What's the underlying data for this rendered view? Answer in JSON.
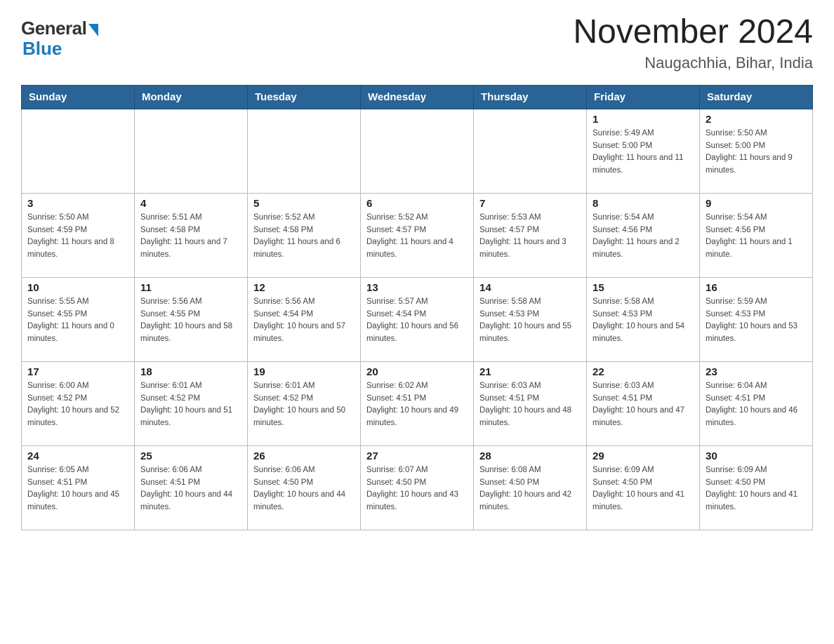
{
  "header": {
    "logo_general": "General",
    "logo_blue": "Blue",
    "month_title": "November 2024",
    "location": "Naugachhia, Bihar, India"
  },
  "days_of_week": [
    "Sunday",
    "Monday",
    "Tuesday",
    "Wednesday",
    "Thursday",
    "Friday",
    "Saturday"
  ],
  "weeks": [
    [
      {
        "day": "",
        "info": ""
      },
      {
        "day": "",
        "info": ""
      },
      {
        "day": "",
        "info": ""
      },
      {
        "day": "",
        "info": ""
      },
      {
        "day": "",
        "info": ""
      },
      {
        "day": "1",
        "info": "Sunrise: 5:49 AM\nSunset: 5:00 PM\nDaylight: 11 hours and 11 minutes."
      },
      {
        "day": "2",
        "info": "Sunrise: 5:50 AM\nSunset: 5:00 PM\nDaylight: 11 hours and 9 minutes."
      }
    ],
    [
      {
        "day": "3",
        "info": "Sunrise: 5:50 AM\nSunset: 4:59 PM\nDaylight: 11 hours and 8 minutes."
      },
      {
        "day": "4",
        "info": "Sunrise: 5:51 AM\nSunset: 4:58 PM\nDaylight: 11 hours and 7 minutes."
      },
      {
        "day": "5",
        "info": "Sunrise: 5:52 AM\nSunset: 4:58 PM\nDaylight: 11 hours and 6 minutes."
      },
      {
        "day": "6",
        "info": "Sunrise: 5:52 AM\nSunset: 4:57 PM\nDaylight: 11 hours and 4 minutes."
      },
      {
        "day": "7",
        "info": "Sunrise: 5:53 AM\nSunset: 4:57 PM\nDaylight: 11 hours and 3 minutes."
      },
      {
        "day": "8",
        "info": "Sunrise: 5:54 AM\nSunset: 4:56 PM\nDaylight: 11 hours and 2 minutes."
      },
      {
        "day": "9",
        "info": "Sunrise: 5:54 AM\nSunset: 4:56 PM\nDaylight: 11 hours and 1 minute."
      }
    ],
    [
      {
        "day": "10",
        "info": "Sunrise: 5:55 AM\nSunset: 4:55 PM\nDaylight: 11 hours and 0 minutes."
      },
      {
        "day": "11",
        "info": "Sunrise: 5:56 AM\nSunset: 4:55 PM\nDaylight: 10 hours and 58 minutes."
      },
      {
        "day": "12",
        "info": "Sunrise: 5:56 AM\nSunset: 4:54 PM\nDaylight: 10 hours and 57 minutes."
      },
      {
        "day": "13",
        "info": "Sunrise: 5:57 AM\nSunset: 4:54 PM\nDaylight: 10 hours and 56 minutes."
      },
      {
        "day": "14",
        "info": "Sunrise: 5:58 AM\nSunset: 4:53 PM\nDaylight: 10 hours and 55 minutes."
      },
      {
        "day": "15",
        "info": "Sunrise: 5:58 AM\nSunset: 4:53 PM\nDaylight: 10 hours and 54 minutes."
      },
      {
        "day": "16",
        "info": "Sunrise: 5:59 AM\nSunset: 4:53 PM\nDaylight: 10 hours and 53 minutes."
      }
    ],
    [
      {
        "day": "17",
        "info": "Sunrise: 6:00 AM\nSunset: 4:52 PM\nDaylight: 10 hours and 52 minutes."
      },
      {
        "day": "18",
        "info": "Sunrise: 6:01 AM\nSunset: 4:52 PM\nDaylight: 10 hours and 51 minutes."
      },
      {
        "day": "19",
        "info": "Sunrise: 6:01 AM\nSunset: 4:52 PM\nDaylight: 10 hours and 50 minutes."
      },
      {
        "day": "20",
        "info": "Sunrise: 6:02 AM\nSunset: 4:51 PM\nDaylight: 10 hours and 49 minutes."
      },
      {
        "day": "21",
        "info": "Sunrise: 6:03 AM\nSunset: 4:51 PM\nDaylight: 10 hours and 48 minutes."
      },
      {
        "day": "22",
        "info": "Sunrise: 6:03 AM\nSunset: 4:51 PM\nDaylight: 10 hours and 47 minutes."
      },
      {
        "day": "23",
        "info": "Sunrise: 6:04 AM\nSunset: 4:51 PM\nDaylight: 10 hours and 46 minutes."
      }
    ],
    [
      {
        "day": "24",
        "info": "Sunrise: 6:05 AM\nSunset: 4:51 PM\nDaylight: 10 hours and 45 minutes."
      },
      {
        "day": "25",
        "info": "Sunrise: 6:06 AM\nSunset: 4:51 PM\nDaylight: 10 hours and 44 minutes."
      },
      {
        "day": "26",
        "info": "Sunrise: 6:06 AM\nSunset: 4:50 PM\nDaylight: 10 hours and 44 minutes."
      },
      {
        "day": "27",
        "info": "Sunrise: 6:07 AM\nSunset: 4:50 PM\nDaylight: 10 hours and 43 minutes."
      },
      {
        "day": "28",
        "info": "Sunrise: 6:08 AM\nSunset: 4:50 PM\nDaylight: 10 hours and 42 minutes."
      },
      {
        "day": "29",
        "info": "Sunrise: 6:09 AM\nSunset: 4:50 PM\nDaylight: 10 hours and 41 minutes."
      },
      {
        "day": "30",
        "info": "Sunrise: 6:09 AM\nSunset: 4:50 PM\nDaylight: 10 hours and 41 minutes."
      }
    ]
  ]
}
